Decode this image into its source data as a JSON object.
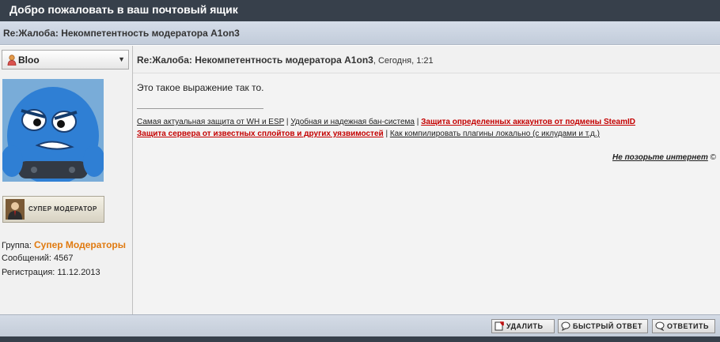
{
  "header": {
    "title": "Добро пожаловать в ваш почтовый ящик"
  },
  "thread": {
    "title": "Re:Жалоба: Некомпетентность модератора A1on3"
  },
  "user": {
    "name": "Bloo",
    "badge": "СУПЕР МОДЕРАТОР",
    "group_label": "Группа:",
    "group_value": "Супер Модераторы",
    "posts_label": "Сообщений:",
    "posts_value": "4567",
    "reg_label": "Регистрация:",
    "reg_value": "11.12.2013"
  },
  "post": {
    "title": "Re:Жалоба: Некомпетентность модератора A1on3",
    "date": ", Сегодня, 1:21",
    "message": "Это такое выражение так то."
  },
  "signature": {
    "link1": "Самая актуальная защита от WH и ESP",
    "sep": "|",
    "link2": "Удобная и надежная бан-система",
    "link3": "Защита определенных аккаунтов от подмены SteamID",
    "link4": "Защита сервера от известных сплойтов и других уязвимостей",
    "link5": "Как компилировать плагины локально (с иклудами и т.д.)",
    "credit_link": "Не позорьте интернет",
    "credit_symbol": "©"
  },
  "actions": {
    "delete": "УДАЛИТЬ",
    "quick_reply": "БЫСТРЫЙ ОТВЕТ",
    "reply": "ОТВЕТИТЬ"
  }
}
